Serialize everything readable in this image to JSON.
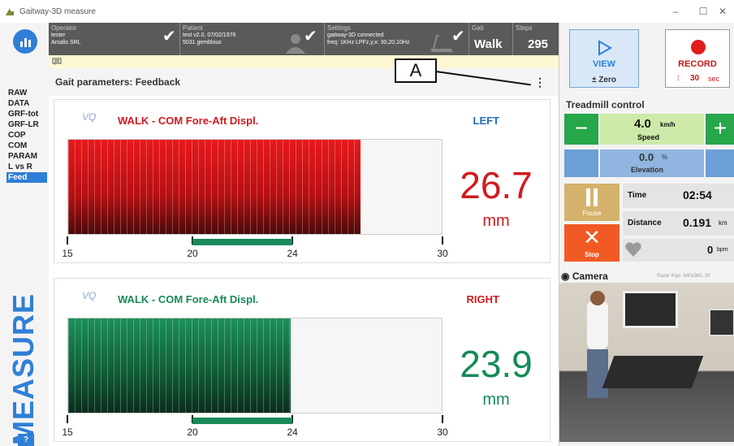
{
  "window": {
    "title": "Gaitway-3D measure",
    "controls": [
      "–",
      "☐",
      "✕"
    ]
  },
  "sidebar": {
    "items": [
      "RAW",
      "DATA",
      "GRF-tot",
      "GRF-LR",
      "COP",
      "COM",
      "PARAM",
      "L vs R",
      "Feed"
    ],
    "active": "Feed",
    "vertical_label": "MEASURE",
    "help_label": "?"
  },
  "topbar": {
    "operator": {
      "label": "Operator",
      "line1": "tester",
      "line2": "Arsalis SRL"
    },
    "patient": {
      "label": "Patient",
      "line1": "test v2.0, 07/02/1976",
      "line2": "5031 gembloux"
    },
    "settings": {
      "label": "Settings",
      "line1": "gaitway-3D connected",
      "line2": "freq: 1KHz   LPFz,y,x: 30,20,10Hz"
    },
    "gait": {
      "label": "Gait",
      "value": "Walk"
    },
    "steps": {
      "label": "Steps",
      "value": "295"
    }
  },
  "params": {
    "title": "Gait parameters: Feedback",
    "menu_icon": "kebab-menu-icon"
  },
  "callout": {
    "label": "A"
  },
  "panels": [
    {
      "logo": "VQ",
      "title": "WALK - COM Fore-Aft Displ.",
      "side": "LEFT",
      "value": "26.7",
      "unit": "mm",
      "accent": "#d11a1e",
      "side_color": "#2a6bb8",
      "bar_value": 26.7,
      "axis_min": 15,
      "axis_max": 30,
      "target_min": 20,
      "target_max": 24,
      "ticks": [
        "15",
        "20",
        "24",
        "30"
      ]
    },
    {
      "logo": "VQ",
      "title": "WALK - COM Fore-Aft Displ.",
      "side": "RIGHT",
      "value": "23.9",
      "unit": "mm",
      "accent": "#178a57",
      "side_color": "#d11a1e",
      "bar_value": 23.9,
      "axis_min": 15,
      "axis_max": 30,
      "target_min": 20,
      "target_max": 24,
      "ticks": [
        "15",
        "20",
        "24",
        "30"
      ]
    }
  ],
  "right": {
    "view_label": "VIEW",
    "zero_label": "± Zero",
    "record_label": "RECORD",
    "record_time": "30",
    "record_unit": "sec",
    "treadmill_title": "Treadmill control",
    "speed_value": "4.0",
    "speed_unit": "km/h",
    "speed_label": "Speed",
    "elevation_value": "0.0",
    "elevation_unit": "%",
    "elevation_label": "Elevation",
    "pause_label": "Pause",
    "stop_label": "Stop",
    "time_label": "Time",
    "time_value": "02:54",
    "distance_label": "Distance",
    "distance_value": "0.191",
    "distance_unit": "km",
    "heart_value": "0",
    "heart_unit": "bpm",
    "camera_title": "Camera",
    "camera_sub": "Razer Kiyo, 640x360, 30"
  },
  "colors": {
    "brand_blue": "#2f7fd6",
    "green": "#178a57",
    "red": "#d11a1e",
    "orange": "#f15a24",
    "tan": "#d4b26b"
  }
}
